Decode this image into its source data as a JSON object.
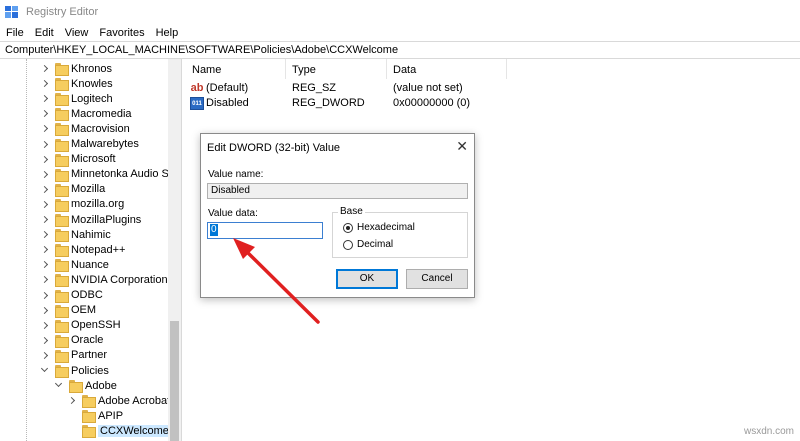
{
  "window": {
    "title": "Registry Editor"
  },
  "menu": [
    "File",
    "Edit",
    "View",
    "Favorites",
    "Help"
  ],
  "address": "Computer\\HKEY_LOCAL_MACHINE\\SOFTWARE\\Policies\\Adobe\\CCXWelcome",
  "tree": {
    "items": [
      "Khronos",
      "Knowles",
      "Logitech",
      "Macromedia",
      "Macrovision",
      "Malwarebytes",
      "Microsoft",
      "Minnetonka Audio So",
      "Mozilla",
      "mozilla.org",
      "MozillaPlugins",
      "Nahimic",
      "Notepad++",
      "Nuance",
      "NVIDIA Corporation",
      "ODBC",
      "OEM",
      "OpenSSH",
      "Oracle",
      "Partner",
      "Policies"
    ],
    "adobe": "Adobe",
    "adobe_children": [
      "Adobe Acrobat",
      "APIP",
      "CCXWelcome"
    ]
  },
  "list": {
    "headers": [
      "Name",
      "Type",
      "Data"
    ],
    "rows": [
      {
        "name": "(Default)",
        "type": "REG_SZ",
        "data": "(value not set)",
        "icon": "string-value-icon"
      },
      {
        "name": "Disabled",
        "type": "REG_DWORD",
        "data": "0x00000000 (0)",
        "icon": "dword-value-icon"
      }
    ]
  },
  "dialog": {
    "title": "Edit DWORD (32-bit) Value",
    "close": "✕",
    "value_name_label": "Value name:",
    "value_name": "Disabled",
    "value_data_label": "Value data:",
    "value_data": "0",
    "base_label": "Base",
    "hex_label": "Hexadecimal",
    "dec_label": "Decimal",
    "selected_base": "Hexadecimal",
    "ok": "OK",
    "cancel": "Cancel"
  },
  "watermark": "wsxdn.com",
  "colors": {
    "arrow": "#e02020",
    "selection": "#cce8ff",
    "accent": "#0078d7"
  }
}
